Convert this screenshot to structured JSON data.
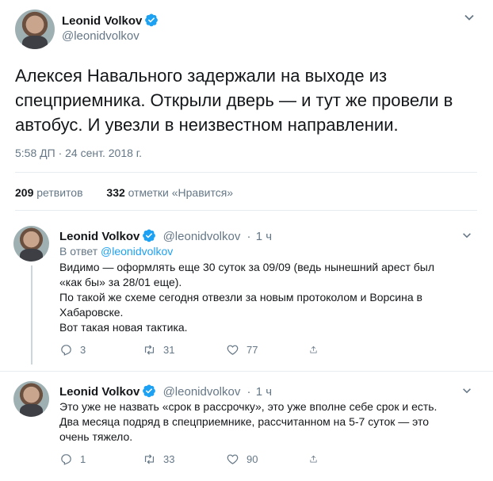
{
  "main_tweet": {
    "author_name": "Leonid Volkov",
    "author_handle": "@leonidvolkov",
    "text": "Алексея Навального задержали на выходе из спецприемника. Открыли дверь — и тут же провели в автобус. И увезли в неизвестном направлении.",
    "timestamp": "5:58 ДП · 24 сент. 2018 г.",
    "retweets_count": "209",
    "retweets_label": "ретвитов",
    "likes_count": "332",
    "likes_label": "отметки «Нравится»"
  },
  "replies": [
    {
      "author_name": "Leonid Volkov",
      "author_handle": "@leonidvolkov",
      "age": "1 ч",
      "reply_to_prefix": "В ответ",
      "reply_to_handle": "@leonidvolkov",
      "lines": [
        "Видимо — оформлять еще 30 суток за 09/09 (ведь нынешний арест был",
        "«как бы» за 28/01 еще).",
        "По такой же схеме сегодня отвезли за новым протоколом и Ворсина в",
        "Хабаровске.",
        "Вот такая новая тактика."
      ],
      "replies_count": "3",
      "retweets_count": "31",
      "likes_count": "77"
    },
    {
      "author_name": "Leonid Volkov",
      "author_handle": "@leonidvolkov",
      "age": "1 ч",
      "lines": [
        "Это уже не назвать «срок в рассрочку», это уже вполне себе срок и есть.",
        "Два месяца подряд в спецприемнике, рассчитанном на 5-7 суток — это",
        "очень тяжело."
      ],
      "replies_count": "1",
      "retweets_count": "33",
      "likes_count": "90"
    }
  ],
  "colors": {
    "accent": "#1da1f2",
    "muted": "#657786",
    "text": "#14171a",
    "divider": "#e6ecf0"
  },
  "icons": {
    "verified": "verified-badge-icon",
    "chevron": "chevron-down-icon",
    "reply": "reply-icon",
    "retweet": "retweet-icon",
    "like": "heart-icon",
    "share": "share-icon"
  }
}
